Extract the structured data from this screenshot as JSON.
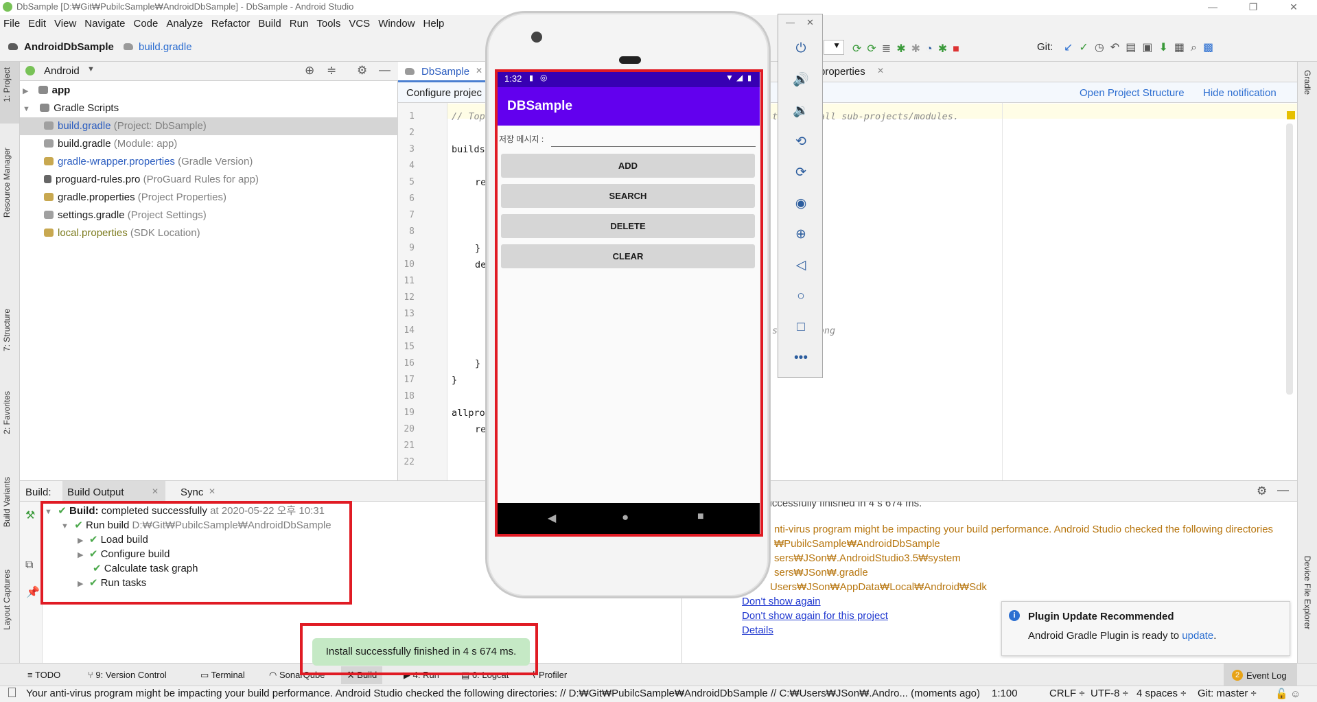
{
  "window": {
    "title": "DbSample [D:₩Git₩PubilcSample₩AndroidDbSample] - DbSample - Android Studio",
    "minimize": "—",
    "maximize": "❐",
    "close": "✕"
  },
  "menu": [
    "File",
    "Edit",
    "View",
    "Navigate",
    "Code",
    "Analyze",
    "Refactor",
    "Build",
    "Run",
    "Tools",
    "VCS",
    "Window",
    "Help"
  ],
  "breadcrumb": {
    "project": "AndroidDbSample",
    "file": "build.gradle"
  },
  "toolbar": {
    "git_label": "Git:"
  },
  "left_strip": {
    "project": "1: Project",
    "resource": "Resource Manager",
    "structure": "7: Structure",
    "favorites": "2: Favorites",
    "variants": "Build Variants",
    "captures": "Layout Captures"
  },
  "right_strip": {
    "gradle": "Gradle",
    "device_explorer": "Device File Explorer"
  },
  "project_panel": {
    "view": "Android",
    "tree": [
      {
        "name": "app",
        "hint": ""
      },
      {
        "name": "Gradle Scripts",
        "hint": ""
      },
      {
        "name": "build.gradle",
        "hint": "(Project: DbSample)"
      },
      {
        "name": "build.gradle",
        "hint": "(Module: app)"
      },
      {
        "name": "gradle-wrapper.properties",
        "hint": "(Gradle Version)"
      },
      {
        "name": "proguard-rules.pro",
        "hint": "(ProGuard Rules for app)"
      },
      {
        "name": "gradle.properties",
        "hint": "(Project Properties)"
      },
      {
        "name": "settings.gradle",
        "hint": "(Project Settings)"
      },
      {
        "name": "local.properties",
        "hint": "(SDK Location)"
      }
    ]
  },
  "editor": {
    "tab_active": "DbSample",
    "tab_other": "properties",
    "notification": "Configure projec",
    "notif_link1": "Open Project Structure",
    "notif_link2": "Hide notification",
    "line_numbers": [
      "1",
      "2",
      "3",
      "4",
      "5",
      "6",
      "7",
      "8",
      "9",
      "10",
      "11",
      "12",
      "13",
      "14",
      "15",
      "16",
      "17",
      "18",
      "19",
      "20",
      "21",
      "22"
    ],
    "line1_left": "// Top",
    "line1_right": "t",
    "line1_tail": "on to all sub-projects/modules.",
    "code_buildscript": "builds",
    "code_re1": "re",
    "code_brace1": "}",
    "code_de": "de",
    "code_brace2": "}",
    "code_brace3": "}",
    "code_allpro": "allpro",
    "code_re2": "re",
    "code_belong": "ey belong",
    "code_belong_s": "s"
  },
  "build_panel": {
    "label": "Build:",
    "tab_output": "Build Output",
    "tab_sync": "Sync",
    "rows": [
      {
        "bold": "Build:",
        "text": "completed successfully",
        "hint": "at 2020-05-22 오후 10:31"
      },
      {
        "bold": "",
        "text": "Run build",
        "hint": "D:₩Git₩PubilcSample₩AndroidDbSample"
      },
      {
        "bold": "",
        "text": "Load build",
        "hint": ""
      },
      {
        "bold": "",
        "text": "Configure build",
        "hint": ""
      },
      {
        "bold": "",
        "text": "Calculate task graph",
        "hint": ""
      },
      {
        "bold": "",
        "text": "Run tasks",
        "hint": ""
      }
    ],
    "log_top": "successfully finished in 4 s 674 ms.",
    "warn1": "nti-virus program might be impacting your build performance. Android Studio checked the following directories",
    "warn2": "₩PubilcSample₩AndroidDbSample",
    "warn3": "sers₩JSon₩.AndroidStudio3.5₩system",
    "warn4": "sers₩JSon₩.gradle",
    "warn5": "Users₩JSon₩AppData₩Local₩Android₩Sdk",
    "link1": "Don't show again",
    "link2": "Don't show again for this project",
    "link3": "Details"
  },
  "popup": {
    "title": "Plugin Update Recommended",
    "text": "Android Gradle Plugin is ready to",
    "link": "update",
    "period": "."
  },
  "tool_windows": [
    "TODO",
    "9: Version Control",
    "Terminal",
    "SonarQube",
    "Build",
    "4: Run",
    "6: Logcat",
    "Profiler"
  ],
  "event_log": {
    "count": "2",
    "label": "Event Log"
  },
  "status": {
    "message": "Your anti-virus program might be impacting your build performance. Android Studio checked the following directories: // D:₩Git₩PubilcSample₩AndroidDbSample // C:₩Users₩JSon₩.Andro... (moments ago)",
    "position": "1:100",
    "line_sep": "CRLF ÷",
    "encoding": "UTF-8 ÷",
    "indent": "4 spaces ÷",
    "branch": "Git: master ÷"
  },
  "toast": "Install successfully finished in 4 s 674 ms.",
  "emulator": {
    "status_time": "1:32",
    "app_title": "DBSample",
    "input_label": "저장 메시지 :",
    "buttons": [
      "ADD",
      "SEARCH",
      "DELETE",
      "CLEAR"
    ],
    "colors": {
      "appbar": "#6200ee",
      "statusbar": "#3700b3",
      "navbar": "#000000"
    }
  },
  "colors": {
    "highlight_red": "#e01b24",
    "success_green": "#4aa84a",
    "link_blue": "#2038d0"
  }
}
